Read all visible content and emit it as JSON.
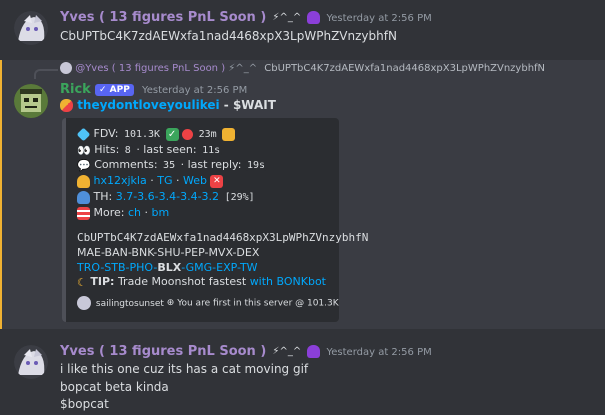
{
  "messages": [
    {
      "author": "Yves ( 13 figures PnL Soon )",
      "tag": "⚡^_^",
      "timestamp": "Yesterday at 2:56 PM",
      "content": "CbUPTbC4K7zdAEWxfa1nad4468xpX3LpWPhZVnzybhfN"
    },
    {
      "reply": {
        "author": "@Yves ( 13 figures PnL Soon )",
        "tag": "⚡^_^",
        "content": "CbUPTbC4K7zdAEWxfa1nad4468xpX3LpWPhZVnzybhfN"
      },
      "author": "Rick",
      "badge": "✓ APP",
      "timestamp": "Yesterday at 2:56 PM",
      "headline_link": "theydontloveyoulikei",
      "headline_sep": " - ",
      "headline_ticker": "$WAIT",
      "embed": {
        "fdv_label": "FDV:",
        "fdv_value": "101.3K",
        "age": "23m",
        "hits_label": "Hits:",
        "hits_value": "8",
        "last_seen_label": "· last seen:",
        "last_seen_value": "11s",
        "comments_label": "Comments:",
        "comments_value": "35",
        "last_reply_label": "· last reply:",
        "last_reply_value": "19s",
        "dev_link": "hx12xjkla",
        "tg_link": "TG",
        "web_link": "Web",
        "th_label": "TH:",
        "th_values": "3.7-3.6-3.4-3.4-3.2",
        "th_percent": "[29%]",
        "more_label": "More:",
        "ch_link": "ch",
        "bm_link": "bm",
        "contract": "CbUPTbC4K7zdAEWxfa1nad4468xpX3LpWPhZVnzybhfN",
        "platforms1": "MAE-BAN-BNK-SHU-PEP-MVX-DEX",
        "platforms2_a": "TRO-STB-PHO-",
        "platforms2_b": "BLX",
        "platforms2_c": "-GMG-EXP-TW",
        "tip_label": "TIP:",
        "tip_text": "Trade Moonshot fastest",
        "tip_link": "with BONKbot",
        "footer_user": "sailingtosunset",
        "footer_text": "You are first in this server @ 101.3K"
      }
    },
    {
      "author": "Yves ( 13 figures PnL Soon )",
      "tag": "⚡^_^",
      "timestamp": "Yesterday at 2:56 PM",
      "lines": [
        "i like this one cuz its has a cat moving gif",
        "bopcat beta kinda",
        "$bopcat"
      ]
    }
  ],
  "colors": {
    "background": "#313338",
    "highlight": "#3a3c43",
    "highlight_bar": "#f0b232",
    "username_yves": "#a78bcd",
    "username_rick": "#3ba55c",
    "link": "#00a8fc"
  }
}
